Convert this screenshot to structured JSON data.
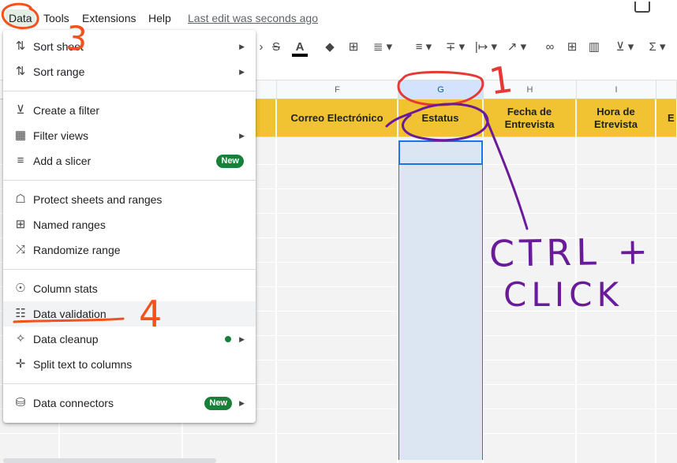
{
  "menubar": {
    "items": [
      "Data",
      "Tools",
      "Extensions",
      "Help"
    ],
    "last_edit": "Last edit was seconds ago"
  },
  "toolbar": {
    "icons": [
      "strikethrough-icon",
      "text-color-icon",
      "fill-color-icon",
      "borders-icon",
      "merge-cells-icon",
      "horizontal-align-icon",
      "vertical-align-icon",
      "text-wrap-icon",
      "text-rotation-icon",
      "insert-link-icon",
      "insert-comment-icon",
      "insert-chart-icon",
      "filter-icon",
      "functions-icon"
    ]
  },
  "sheet": {
    "columns": [
      "F",
      "G",
      "H",
      "I"
    ],
    "headers": {
      "correo": "Correo Electrónico",
      "estatus": "Estatus",
      "fecha_1": "Fecha de",
      "fecha_2": "Entrevista",
      "hora_1": "Hora de",
      "hora_2": "Etrevista",
      "partial": "E"
    }
  },
  "dropdown": {
    "items": {
      "sort_sheet": "Sort sheet",
      "sort_range": "Sort range",
      "create_filter": "Create a filter",
      "filter_views": "Filter views",
      "add_slicer": "Add a slicer",
      "protect": "Protect sheets and ranges",
      "named_ranges": "Named ranges",
      "randomize": "Randomize range",
      "column_stats": "Column stats",
      "data_validation": "Data validation",
      "data_cleanup": "Data cleanup",
      "split_text": "Split text to columns",
      "data_connectors": "Data connectors"
    },
    "badge_new": "New"
  },
  "annotations": {
    "n1": "1",
    "n3": "3",
    "n4": "4",
    "ctrl": "CTRL +",
    "click": "CLICK"
  },
  "colors": {
    "header_fill": "#f1c232",
    "selection": "#1a73e8",
    "new_badge": "#188038",
    "annotation_orange": "#f4511e",
    "annotation_red": "#e53935",
    "annotation_purple": "#6a1b9a"
  }
}
